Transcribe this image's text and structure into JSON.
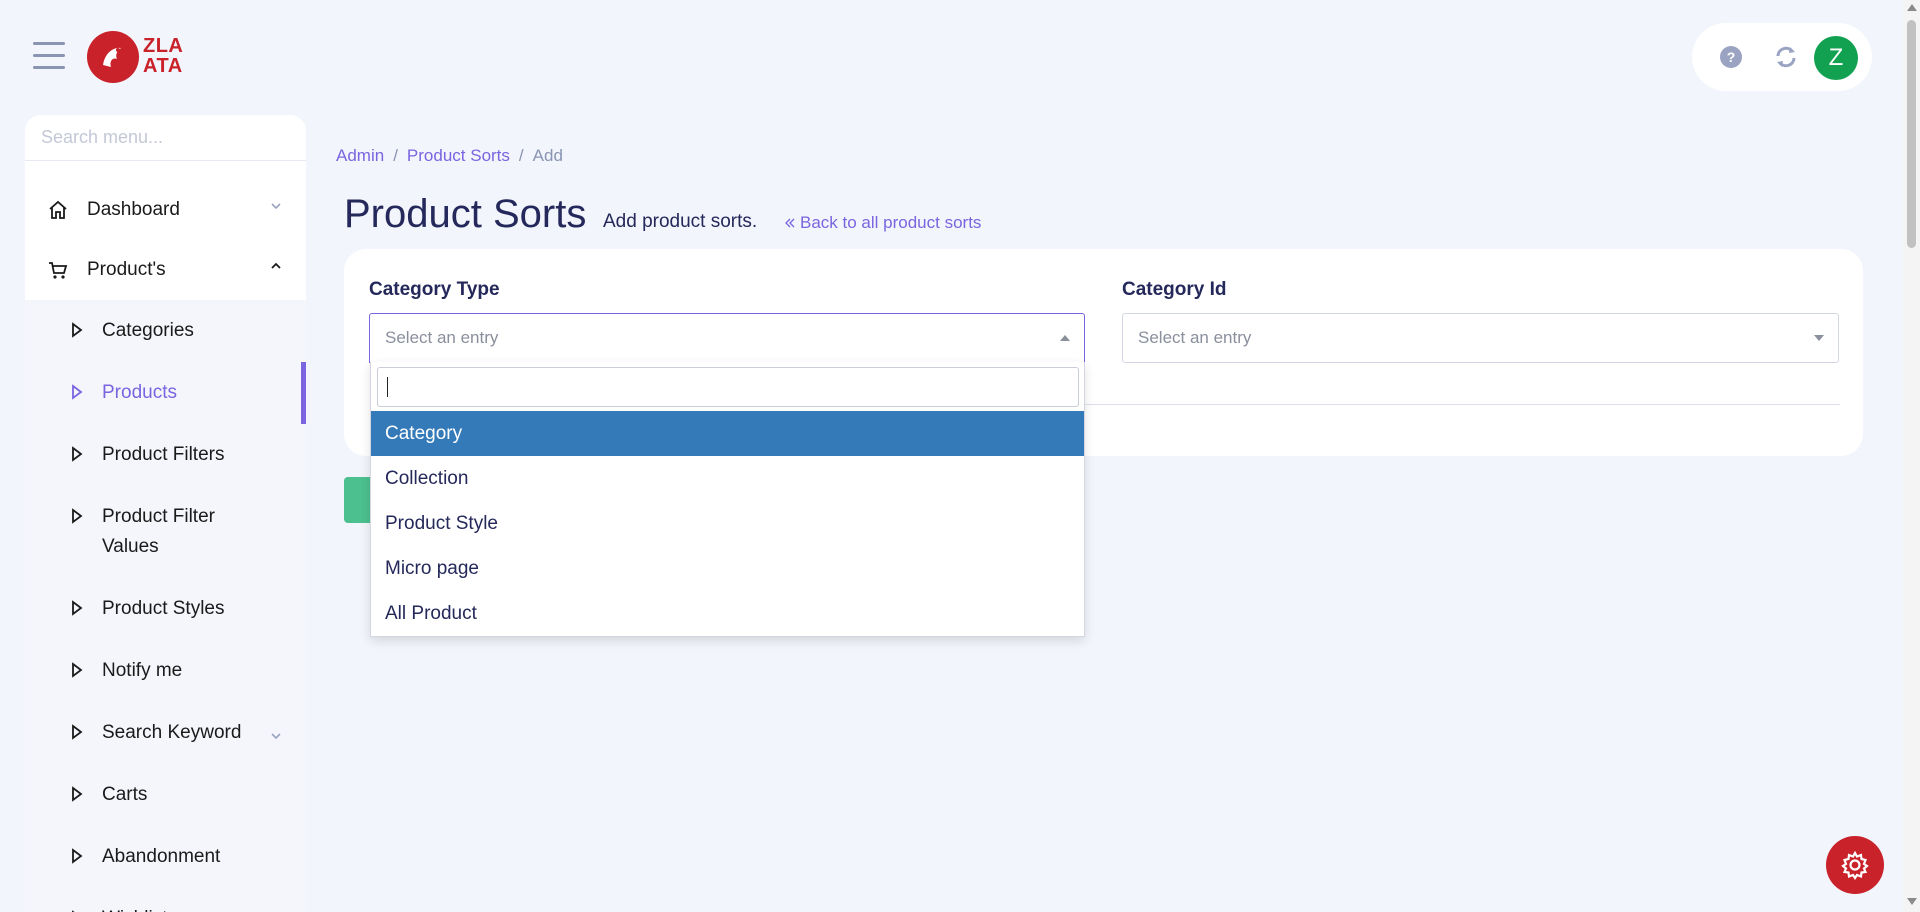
{
  "brand": {
    "logo_line1": "ZLA",
    "logo_line2": "ATA"
  },
  "header": {
    "avatar_initial": "Z"
  },
  "sidebar": {
    "search_placeholder": "Search menu...",
    "dashboard": "Dashboard",
    "products_group": "Product's",
    "items": [
      {
        "label": "Categories"
      },
      {
        "label": "Products"
      },
      {
        "label": "Product Filters"
      },
      {
        "label": "Product Filter Values"
      },
      {
        "label": "Product Styles"
      },
      {
        "label": "Notify me"
      },
      {
        "label": "Search Keyword"
      },
      {
        "label": "Carts"
      },
      {
        "label": "Abandonment"
      },
      {
        "label": "Wishlists"
      }
    ]
  },
  "breadcrumb": {
    "admin": "Admin",
    "section": "Product Sorts",
    "current": "Add",
    "sep": "/"
  },
  "page": {
    "title": "Product Sorts",
    "subtitle": "Add product sorts.",
    "back_link": "Back to all product sorts"
  },
  "form": {
    "category_type_label": "Category Type",
    "category_type_placeholder": "Select an entry",
    "category_id_label": "Category Id",
    "category_id_placeholder": "Select an entry"
  },
  "dropdown": {
    "options": [
      "Category",
      "Collection",
      "Product Style",
      "Micro page",
      "All Product"
    ],
    "highlighted": "Category"
  },
  "colors": {
    "accent": "#7a64e0",
    "brand": "#c9222a",
    "highlight": "#347ab8",
    "avatar": "#12a150"
  }
}
